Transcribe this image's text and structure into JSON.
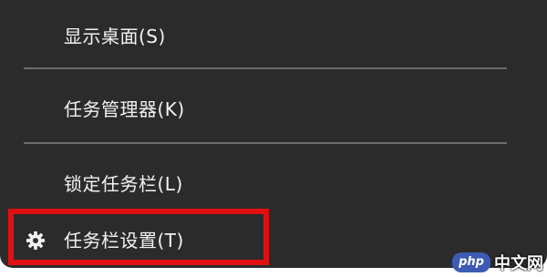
{
  "context_menu": {
    "items": [
      {
        "label": "显示桌面(S)"
      },
      {
        "label": "任务管理器(K)"
      },
      {
        "label": "锁定任务栏(L)"
      },
      {
        "label": "任务栏设置(T)",
        "icon": "gear-icon"
      }
    ]
  },
  "highlight": {
    "color": "#e01010"
  },
  "watermark": {
    "logo": "php",
    "text": "中文网"
  }
}
